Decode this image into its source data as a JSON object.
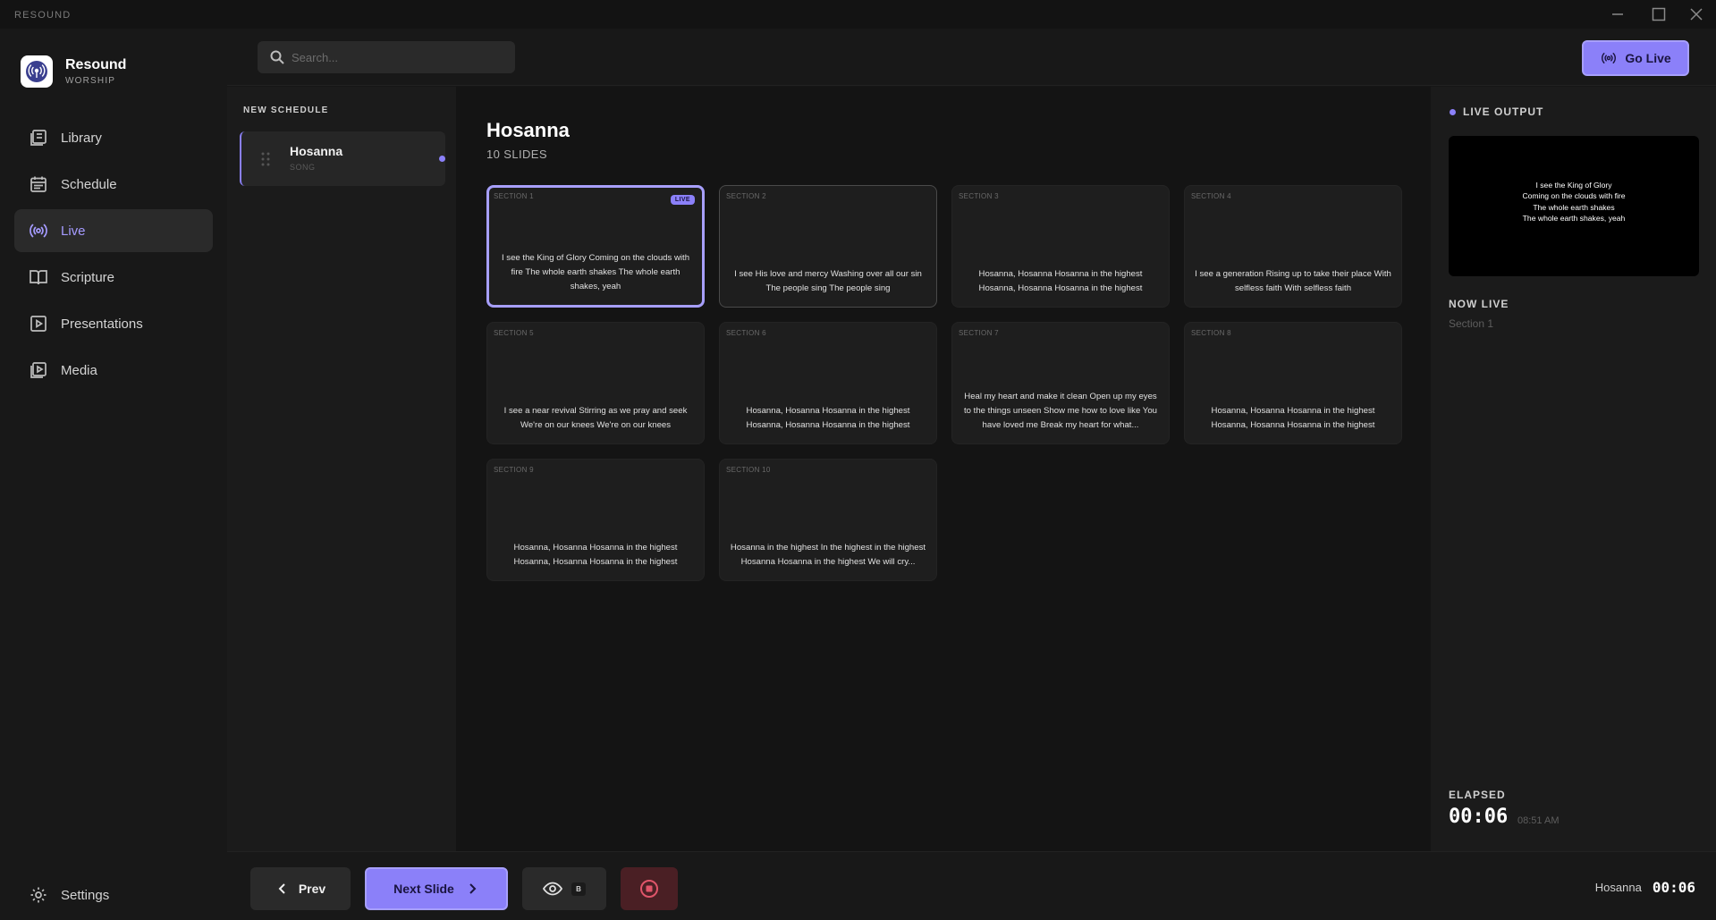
{
  "window": {
    "app_title": "RESOUND"
  },
  "brand": {
    "name": "Resound",
    "subtitle": "WORSHIP"
  },
  "nav": {
    "items": [
      {
        "label": "Library",
        "icon": "library-icon",
        "active": false
      },
      {
        "label": "Schedule",
        "icon": "calendar-icon",
        "active": false
      },
      {
        "label": "Live",
        "icon": "broadcast-icon",
        "active": true
      },
      {
        "label": "Scripture",
        "icon": "book-icon",
        "active": false
      },
      {
        "label": "Presentations",
        "icon": "play-square-icon",
        "active": false
      },
      {
        "label": "Media",
        "icon": "media-icon",
        "active": false
      }
    ],
    "settings_label": "Settings"
  },
  "search": {
    "placeholder": "Search..."
  },
  "toolbar": {
    "go_live_label": "Go Live"
  },
  "schedule": {
    "title": "NEW SCHEDULE",
    "items": [
      {
        "name": "Hosanna",
        "type": "SONG"
      }
    ]
  },
  "main": {
    "title": "Hosanna",
    "count_label": "10 SLIDES",
    "live_badge": "LIVE",
    "slides": [
      {
        "section": "SECTION 1",
        "text": "I see the King of Glory Coming on the clouds with fire The whole earth shakes The whole earth shakes, yeah",
        "live": true
      },
      {
        "section": "SECTION 2",
        "text": "I see His love and mercy Washing over all our sin The people sing The people sing",
        "live": false
      },
      {
        "section": "SECTION 3",
        "text": "Hosanna, Hosanna Hosanna in the highest Hosanna, Hosanna Hosanna in the highest",
        "live": false
      },
      {
        "section": "SECTION 4",
        "text": "I see a generation Rising up to take their place With selfless faith With selfless faith",
        "live": false
      },
      {
        "section": "SECTION 5",
        "text": "I see a near revival Stirring as we pray and seek We're on our knees We're on our knees",
        "live": false
      },
      {
        "section": "SECTION 6",
        "text": "Hosanna, Hosanna Hosanna in the highest Hosanna, Hosanna Hosanna in the highest",
        "live": false
      },
      {
        "section": "SECTION 7",
        "text": "Heal my heart and make it clean Open up my eyes to the things unseen Show me how to love like You have loved me Break my heart for what...",
        "live": false
      },
      {
        "section": "SECTION 8",
        "text": "Hosanna, Hosanna Hosanna in the highest Hosanna, Hosanna Hosanna in the highest",
        "live": false
      },
      {
        "section": "SECTION 9",
        "text": "Hosanna, Hosanna Hosanna in the highest Hosanna, Hosanna Hosanna in the highest",
        "live": false
      },
      {
        "section": "SECTION 10",
        "text": "Hosanna in the highest In the highest in the highest Hosanna Hosanna in the highest We will cry...",
        "live": false
      }
    ]
  },
  "live_output": {
    "title": "LIVE OUTPUT",
    "preview_lines": [
      "I see the King of Glory",
      "Coming on the clouds with fire",
      "The whole earth shakes",
      "The whole earth shakes, yeah"
    ],
    "now_live_label": "NOW LIVE",
    "now_live_value": "Section 1",
    "elapsed_label": "ELAPSED",
    "elapsed_value": "00:06",
    "clock": "08:51 AM"
  },
  "bottom": {
    "prev_label": "Prev",
    "next_label": "Next Slide",
    "blank_key": "B",
    "current_song": "Hosanna",
    "current_time": "00:06"
  },
  "colors": {
    "accent": "#8b80f9",
    "accent_border": "#a79ffc",
    "stop_bg": "#4a1f24",
    "stop_icon": "#e0556a"
  }
}
